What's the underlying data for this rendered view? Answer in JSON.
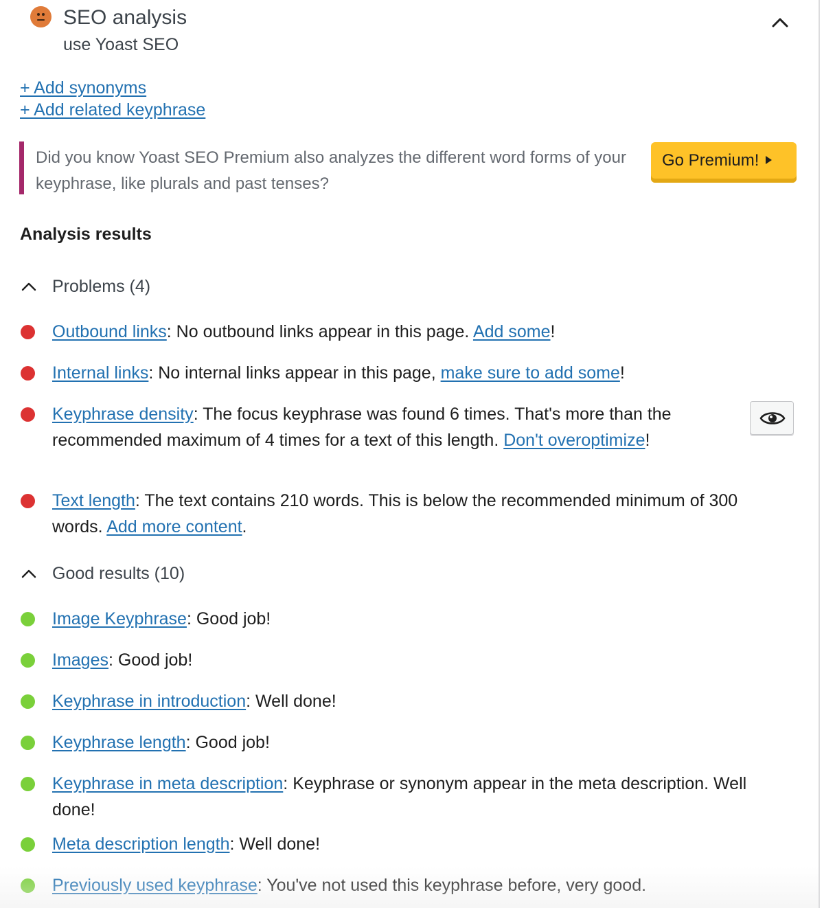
{
  "header": {
    "title": "SEO analysis",
    "subtitle": "use Yoast SEO",
    "status_icon": "neutral-face-icon",
    "status_color": "#e07b39"
  },
  "add_links": {
    "synonyms": "+ Add synonyms",
    "related": "+ Add related keyphrase"
  },
  "notice": {
    "text": "Did you know Yoast SEO Premium also analyzes the different word forms of your keyphrase, like plurals and past tenses?",
    "button": "Go Premium!",
    "accent_color": "#a4286a"
  },
  "analysis_heading": "Analysis results",
  "problems": {
    "label": "Problems (4)",
    "items": [
      {
        "link": "Outbound links",
        "text": ": No outbound links appear in this page. ",
        "link2": "Add some",
        "tail": "!"
      },
      {
        "link": "Internal links",
        "text": ": No internal links appear in this page, ",
        "link2": "make sure to add some",
        "tail": "!"
      },
      {
        "link": "Keyphrase density",
        "text": ": The focus keyphrase was found 6 times. That's more than the recommended maximum of 4 times for a text of this length. ",
        "link2": "Don't overoptimize",
        "tail": "!"
      },
      {
        "link": "Text length",
        "text": ": The text contains 210 words. This is below the recommended minimum of 300 words. ",
        "link2": "Add more content",
        "tail": "."
      }
    ]
  },
  "good": {
    "label": "Good results (10)",
    "items": [
      {
        "link": "Image Keyphrase",
        "text": ": Good job!"
      },
      {
        "link": "Images",
        "text": ": Good job!"
      },
      {
        "link": "Keyphrase in introduction",
        "text": ": Well done!"
      },
      {
        "link": "Keyphrase length",
        "text": ": Good job!"
      },
      {
        "link": "Keyphrase in meta description",
        "text": ": Keyphrase or synonym appear in the meta description. Well done!"
      },
      {
        "link": "Meta description length",
        "text": ": Well done!"
      },
      {
        "link": "Previously used keyphrase",
        "text": ": You've not used this keyphrase before, very good."
      }
    ]
  },
  "colors": {
    "bad": "#dc3232",
    "good": "#7ad03a",
    "link": "#2271b1",
    "premium": "#fec228"
  }
}
